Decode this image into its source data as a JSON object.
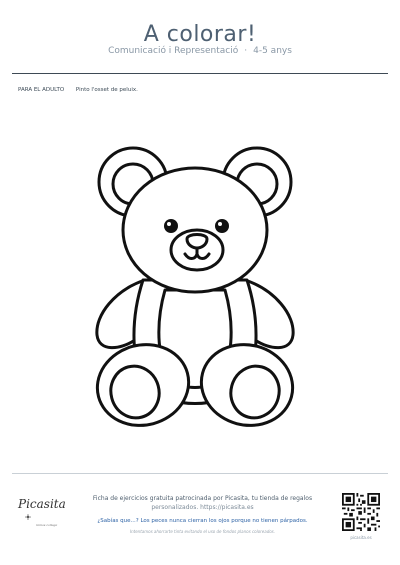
{
  "header": {
    "title": "A colorar!",
    "subject": "Comunicació i Representació",
    "separator": "·",
    "age": "4-5 anys"
  },
  "instructions": {
    "label": "PARA EL ADULTO",
    "text": "Pinto l'osset de peluix."
  },
  "footer": {
    "line1": "Ficha de ejercicios gratuita patrocinada por Picasita, tu tienda de regalos",
    "line2": "personalizados. https://picasita.es",
    "fact": "¿Sabías que...? Los peces nunca cierran los ojos porque no tienen párpados.",
    "note": "Intentamos ahorrarte tinta evitando el uso de fondos planos coloreados.",
    "logo_text": "Picasita",
    "logo_sub": "ramos collage",
    "qr_caption": "picasita.es"
  }
}
